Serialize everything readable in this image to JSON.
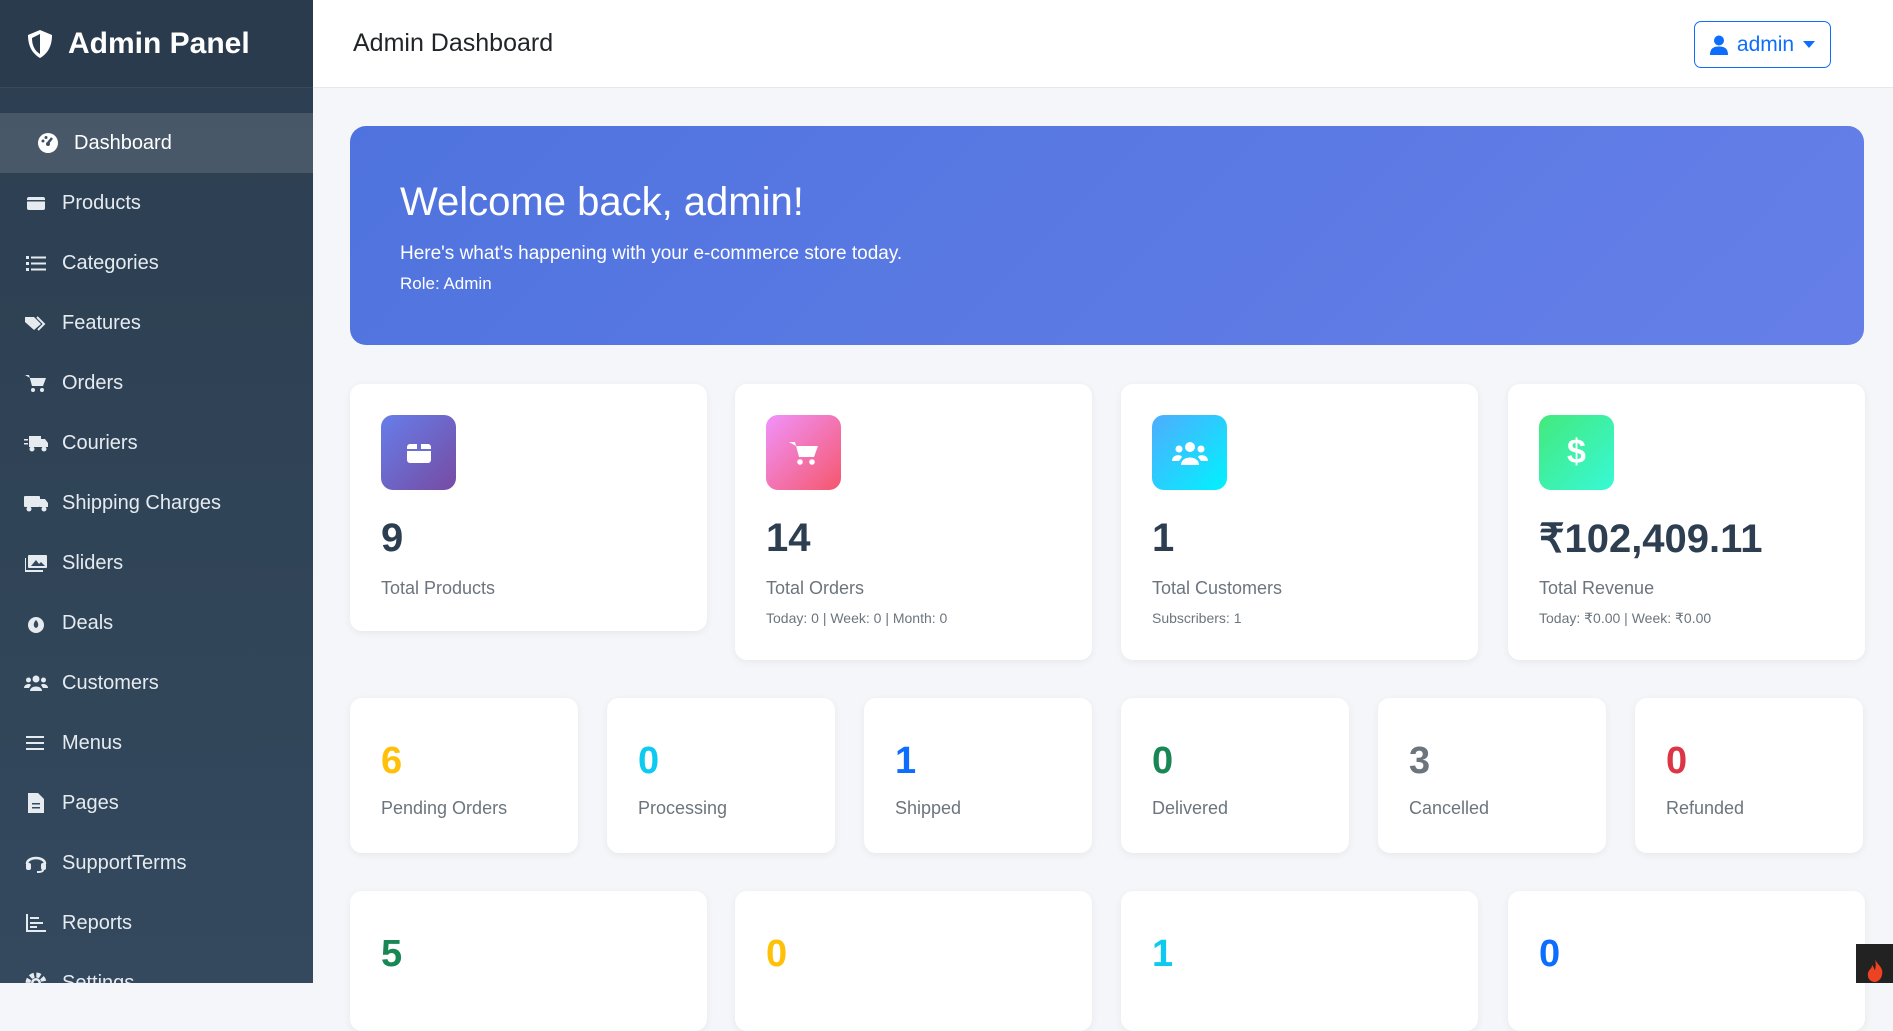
{
  "brand": {
    "title": "Admin Panel"
  },
  "sidebar": {
    "items": [
      {
        "label": "Dashboard",
        "icon": "gauge-icon"
      },
      {
        "label": "Products",
        "icon": "box-icon"
      },
      {
        "label": "Categories",
        "icon": "list-icon"
      },
      {
        "label": "Features",
        "icon": "tags-icon"
      },
      {
        "label": "Orders",
        "icon": "cart-icon"
      },
      {
        "label": "Couriers",
        "icon": "truck-fast-icon"
      },
      {
        "label": "Shipping Charges",
        "icon": "truck-icon"
      },
      {
        "label": "Sliders",
        "icon": "images-icon"
      },
      {
        "label": "Deals",
        "icon": "fire-icon"
      },
      {
        "label": "Customers",
        "icon": "users-icon"
      },
      {
        "label": "Menus",
        "icon": "bars-icon"
      },
      {
        "label": "Pages",
        "icon": "file-icon"
      },
      {
        "label": "SupportTerms",
        "icon": "headset-icon"
      },
      {
        "label": "Reports",
        "icon": "chart-bar-icon"
      },
      {
        "label": "Settings",
        "icon": "gear-icon"
      }
    ]
  },
  "header": {
    "title": "Admin Dashboard",
    "user": "admin"
  },
  "banner": {
    "heading": "Welcome back, admin!",
    "text": "Here's what's happening with your e-commerce store today.",
    "role": "Role: Admin"
  },
  "stats": [
    {
      "value": "9",
      "label": "Total Products",
      "sub": ""
    },
    {
      "value": "14",
      "label": "Total Orders",
      "sub": "Today: 0 | Week: 0 | Month: 0"
    },
    {
      "value": "1",
      "label": "Total Customers",
      "sub": "Subscribers: 1"
    },
    {
      "value": "₹102,409.11",
      "label": "Total Revenue",
      "sub": "Today: ₹0.00 | Week: ₹0.00"
    }
  ],
  "order_status": [
    {
      "value": "6",
      "label": "Pending Orders",
      "color": "#ffc107"
    },
    {
      "value": "0",
      "label": "Processing",
      "color": "#0dcaf0"
    },
    {
      "value": "1",
      "label": "Shipped",
      "color": "#0d6efd"
    },
    {
      "value": "0",
      "label": "Delivered",
      "color": "#198754"
    },
    {
      "value": "3",
      "label": "Cancelled",
      "color": "#6c757d"
    },
    {
      "value": "0",
      "label": "Refunded",
      "color": "#dc3545"
    }
  ],
  "row3": [
    {
      "value": "5",
      "color": "#198754"
    },
    {
      "value": "0",
      "color": "#ffc107"
    },
    {
      "value": "1",
      "color": "#0dcaf0"
    },
    {
      "value": "0",
      "color": "#0d6efd"
    }
  ]
}
